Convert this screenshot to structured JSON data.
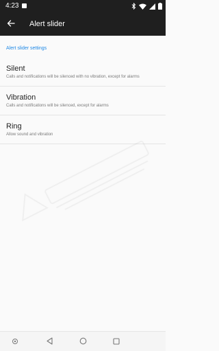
{
  "status_bar": {
    "time": "4:23",
    "icons": [
      "image-icon",
      "bluetooth-icon",
      "wifi-icon",
      "signal-icon",
      "battery-icon"
    ]
  },
  "app_bar": {
    "title": "Alert slider",
    "back_icon": "arrow-back-icon"
  },
  "section": {
    "header": "Alert slider settings"
  },
  "options": [
    {
      "title": "Silent",
      "summary": "Calls and notifications will be silenced with no vibration, except for alarms"
    },
    {
      "title": "Vibration",
      "summary": "Calls and notifications will be silenced, except for alarms"
    },
    {
      "title": "Ring",
      "summary": "Allow sound and vibration"
    }
  ],
  "nav_bar": {
    "icons": [
      "navbar-pin-icon",
      "back-triangle-icon",
      "home-circle-icon",
      "recents-square-icon"
    ]
  },
  "colors": {
    "bar_background": "#1f1f1f",
    "accent": "#1e88e5",
    "background": "#fafafa"
  }
}
